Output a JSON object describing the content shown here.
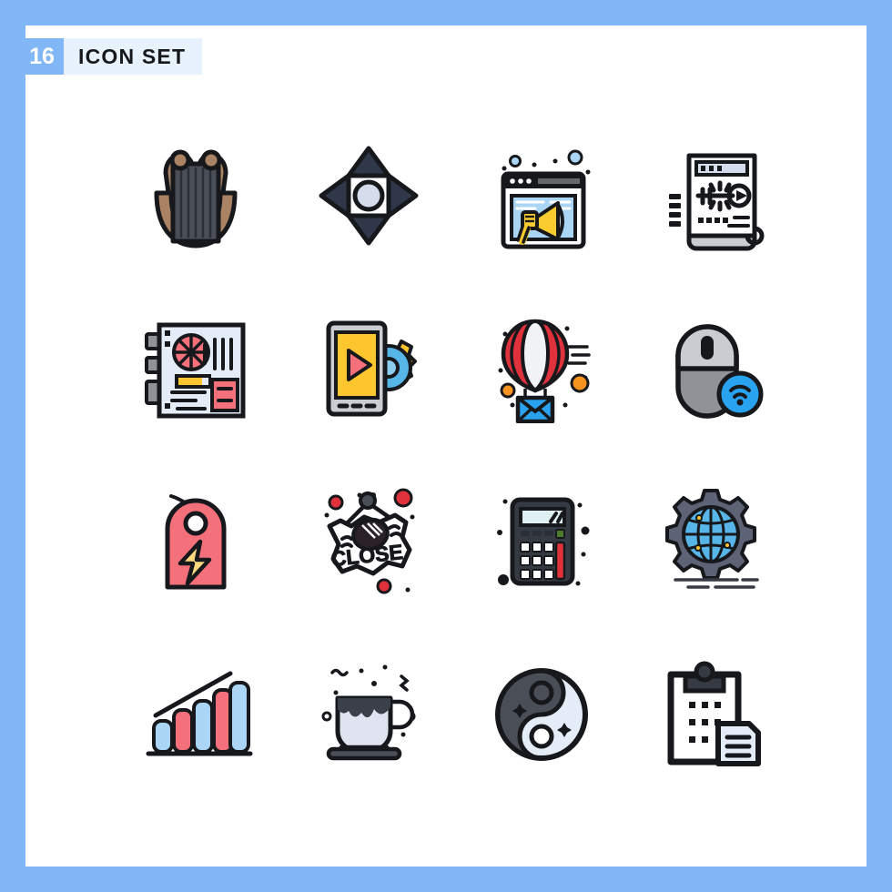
{
  "header": {
    "count": "16",
    "title": "ICON SET"
  },
  "colors": {
    "frame_blue": "#82b7f7",
    "badge_blue": "#82b7f7",
    "title_bg": "#e8f2fd",
    "canvas": "#ffffff",
    "outline": "#16181c",
    "lyre_brown": "#a98364",
    "lyre_strings": "#4a4e57",
    "navy": "#2f3749",
    "light_lavender": "#d5dcec",
    "sky_blue": "#aad5f5",
    "yellow": "#f9cb2e",
    "gold": "#fdc62e",
    "salmon": "#f4707a",
    "red": "#e0323c",
    "orange": "#f79420",
    "light_gray": "#c9ccd1",
    "mid_gray": "#8f9398",
    "gray_blue": "#5d6375",
    "pale_blue": "#e4ecf8",
    "white": "#ffffff",
    "dark_slate": "#353a43",
    "green": "#4c7a2e",
    "globe_blue": "#57b5e8"
  },
  "grid": {
    "rows": 4,
    "cols": 4,
    "icons": [
      {
        "position": "r1c1",
        "name": "lyre-harp-icon",
        "label": "Lyre"
      },
      {
        "position": "r1c2",
        "name": "move-directions-icon",
        "label": "Move"
      },
      {
        "position": "r1c3",
        "name": "browser-megaphone-icon",
        "label": "Online Advertising"
      },
      {
        "position": "r1c4",
        "name": "document-key-icon",
        "label": "Key Document"
      },
      {
        "position": "r2c1",
        "name": "motherboard-icon",
        "label": "Motherboard"
      },
      {
        "position": "r2c2",
        "name": "mobile-video-settings-icon",
        "label": "Video Settings"
      },
      {
        "position": "r2c3",
        "name": "hot-air-balloon-mail-icon",
        "label": "Email Campaign"
      },
      {
        "position": "r2c4",
        "name": "wireless-mouse-icon",
        "label": "Wireless Mouse"
      },
      {
        "position": "r3c1",
        "name": "flash-sale-tag-icon",
        "label": "Flash Sale Tag"
      },
      {
        "position": "r3c2",
        "name": "close-sign-icon",
        "label": "Close Sign",
        "text": "CLOSE"
      },
      {
        "position": "r3c3",
        "name": "calculator-icon",
        "label": "Calculator"
      },
      {
        "position": "r3c4",
        "name": "global-settings-gear-icon",
        "label": "Global Settings"
      },
      {
        "position": "r4c1",
        "name": "growth-bar-chart-icon",
        "label": "Growth Chart"
      },
      {
        "position": "r4c2",
        "name": "coffee-cup-icon",
        "label": "Coffee Cup"
      },
      {
        "position": "r4c3",
        "name": "yin-yang-icon",
        "label": "Yin Yang"
      },
      {
        "position": "r4c4",
        "name": "clipboard-document-icon",
        "label": "Clipboard Task"
      }
    ]
  }
}
